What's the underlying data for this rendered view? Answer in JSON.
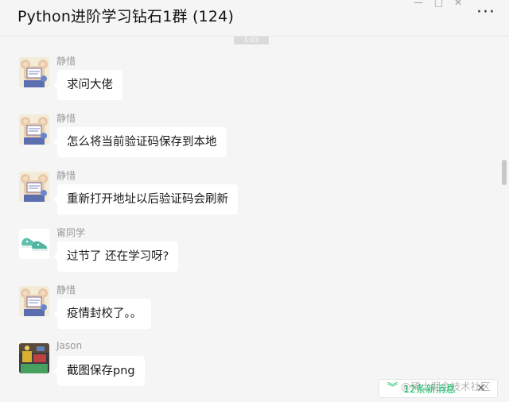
{
  "header": {
    "title": "Python进阶学习钻石1群 (124)",
    "more_label": "···",
    "window_controls": [
      "—",
      "□",
      "✕"
    ]
  },
  "time_chip": "1:03",
  "messages": [
    {
      "sender": "静惜",
      "text": "求问大佬",
      "avatar": "bear-avatar"
    },
    {
      "sender": "静惜",
      "text": "怎么将当前验证码保存到本地",
      "avatar": "bear-avatar"
    },
    {
      "sender": "静惜",
      "text": "重新打开地址以后验证码会刷新",
      "avatar": "bear-avatar"
    },
    {
      "sender": "甯同学",
      "text": "过节了 还在学习呀?",
      "avatar": "shoes-avatar"
    },
    {
      "sender": "静惜",
      "text": "疫情封校了。。",
      "avatar": "bear-avatar"
    },
    {
      "sender": "Jason",
      "text": "截图保存png",
      "avatar": "photo-avatar"
    }
  ],
  "new_messages": {
    "label": "12条新消息",
    "chevron": "︾",
    "close": "✕"
  },
  "watermark": "@稀土掘金技术社区",
  "colors": {
    "accent": "#07c160",
    "background": "#f5f5f5",
    "bubble": "#ffffff"
  }
}
